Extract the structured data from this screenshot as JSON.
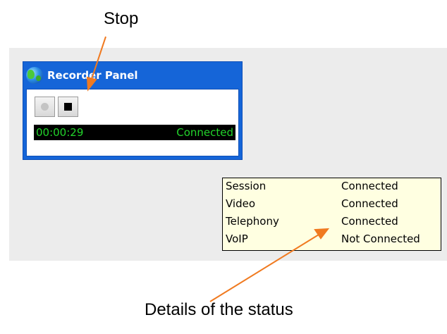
{
  "annotations": {
    "stop_caption": "Stop",
    "details_caption": "Details of the status",
    "arrow_color": "#f07a20"
  },
  "panel": {
    "title": "Recorder Panel",
    "title_icon": "globe-icon",
    "record_button_icon": "record-dot-icon",
    "stop_button_icon": "stop-square-icon",
    "elapsed_time": "00:00:29",
    "status": "Connected",
    "accent_color": "#1565d8",
    "status_text_color": "#22d32b"
  },
  "tooltip": {
    "rows": [
      {
        "label": "Session",
        "value": "Connected"
      },
      {
        "label": "Video",
        "value": "Connected"
      },
      {
        "label": "Telephony",
        "value": "Connected"
      },
      {
        "label": "VoIP",
        "value": "Not Connected"
      }
    ],
    "background_color": "#ffffe1"
  }
}
